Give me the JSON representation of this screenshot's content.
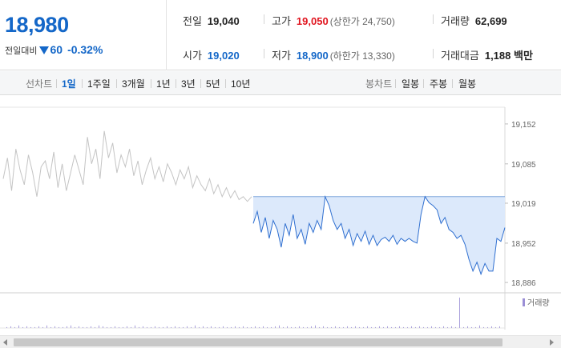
{
  "quote": {
    "price": "18,980",
    "change_label": "전일대비",
    "change_value": "60",
    "change_direction": "down",
    "change_pct": "-0.32%"
  },
  "stats": {
    "prev_close": {
      "label": "전일",
      "value": "19,040"
    },
    "high": {
      "label": "고가",
      "value": "19,050",
      "sub": "(상한가 24,750)"
    },
    "volume": {
      "label": "거래량",
      "value": "62,699"
    },
    "open": {
      "label": "시가",
      "value": "19,020"
    },
    "low": {
      "label": "저가",
      "value": "18,900",
      "sub": "(하한가 13,330)"
    },
    "trade_amount": {
      "label": "거래대금",
      "value": "1,188 백만"
    }
  },
  "tabs": {
    "line_title": "선차트",
    "line_periods": [
      "1일",
      "1주일",
      "3개월",
      "1년",
      "3년",
      "5년",
      "10년"
    ],
    "active_line_period": "1일",
    "candle_title": "봉차트",
    "candle_periods": [
      "일봉",
      "주봉",
      "월봉"
    ]
  },
  "colors": {
    "accent_blue": "#1467c8",
    "up_red": "#e0141e",
    "series_today": "#2f6fd0",
    "series_fill": "#dce9fb",
    "series_prev": "#c4c4c4",
    "volume_legend": "#9b8fd6"
  },
  "chart_data": {
    "type": "line",
    "ylim": [
      18866,
      19172
    ],
    "y_ticks": [
      "19,152",
      "19,085",
      "19,019",
      "18,952",
      "18,886"
    ],
    "y_tick_values": [
      19152,
      19085,
      19019,
      18952,
      18886
    ],
    "legend": "거래량",
    "series": [
      {
        "name": "",
        "role": "previous-day",
        "values": [
          19060,
          19095,
          19040,
          19110,
          19075,
          19050,
          19100,
          19070,
          19030,
          19080,
          19090,
          19060,
          19105,
          19045,
          19085,
          19040,
          19070,
          19100,
          19075,
          19050,
          19130,
          19085,
          19110,
          19060,
          19140,
          19095,
          19120,
          19070,
          19100,
          19080,
          19110,
          19065,
          19090,
          19050,
          19075,
          19095,
          19060,
          19080,
          19055,
          19085,
          19070,
          19050,
          19075,
          19060,
          19080,
          19045,
          19065,
          19050,
          19040,
          19060,
          19035,
          19050,
          19030,
          19045,
          19028,
          19040,
          19025,
          19030,
          19022,
          19030
        ]
      },
      {
        "name": "",
        "role": "today",
        "baseline": 19030,
        "values": [
          18985,
          19005,
          18970,
          18995,
          18960,
          18990,
          18975,
          18945,
          18985,
          18965,
          19000,
          18960,
          18975,
          18950,
          18985,
          18970,
          18990,
          18975,
          19030,
          19015,
          18990,
          18975,
          18985,
          18960,
          18975,
          18948,
          18968,
          18955,
          18972,
          18950,
          18965,
          18948,
          18958,
          18962,
          18955,
          18965,
          18950,
          18960,
          18955,
          18960,
          18955,
          18952,
          19000,
          19030,
          19020,
          19015,
          19008,
          18985,
          18995,
          18975,
          18970,
          18960,
          18965,
          18950,
          18925,
          18905,
          18920,
          18900,
          18918,
          18905,
          18905,
          18960,
          18955,
          18978
        ]
      }
    ],
    "volume": [
      1,
      2,
      1,
      3,
      1,
      2,
      1,
      1,
      2,
      1,
      3,
      1,
      2,
      1,
      1,
      2,
      3,
      1,
      2,
      1,
      1,
      2,
      1,
      3,
      2,
      1,
      1,
      2,
      1,
      1,
      2,
      1,
      3,
      1,
      2,
      1,
      1,
      2,
      1,
      1,
      2,
      1,
      2,
      1,
      1,
      2,
      1,
      3,
      1,
      2,
      1,
      2,
      1,
      1,
      2,
      1,
      1,
      2,
      1,
      2,
      1,
      1,
      2,
      1,
      2,
      1,
      1,
      2,
      3,
      1,
      2,
      1,
      1,
      2,
      1,
      1,
      2,
      3,
      1,
      2,
      1,
      1,
      2,
      1,
      1,
      2,
      1,
      2,
      1,
      1,
      2,
      1,
      1,
      2,
      1,
      2,
      1,
      1,
      2,
      1,
      1,
      2,
      1,
      2,
      1,
      1,
      2,
      1,
      1,
      2,
      1,
      2,
      1,
      36,
      1,
      2,
      1,
      1,
      3,
      1,
      1,
      2,
      1,
      2
    ]
  }
}
